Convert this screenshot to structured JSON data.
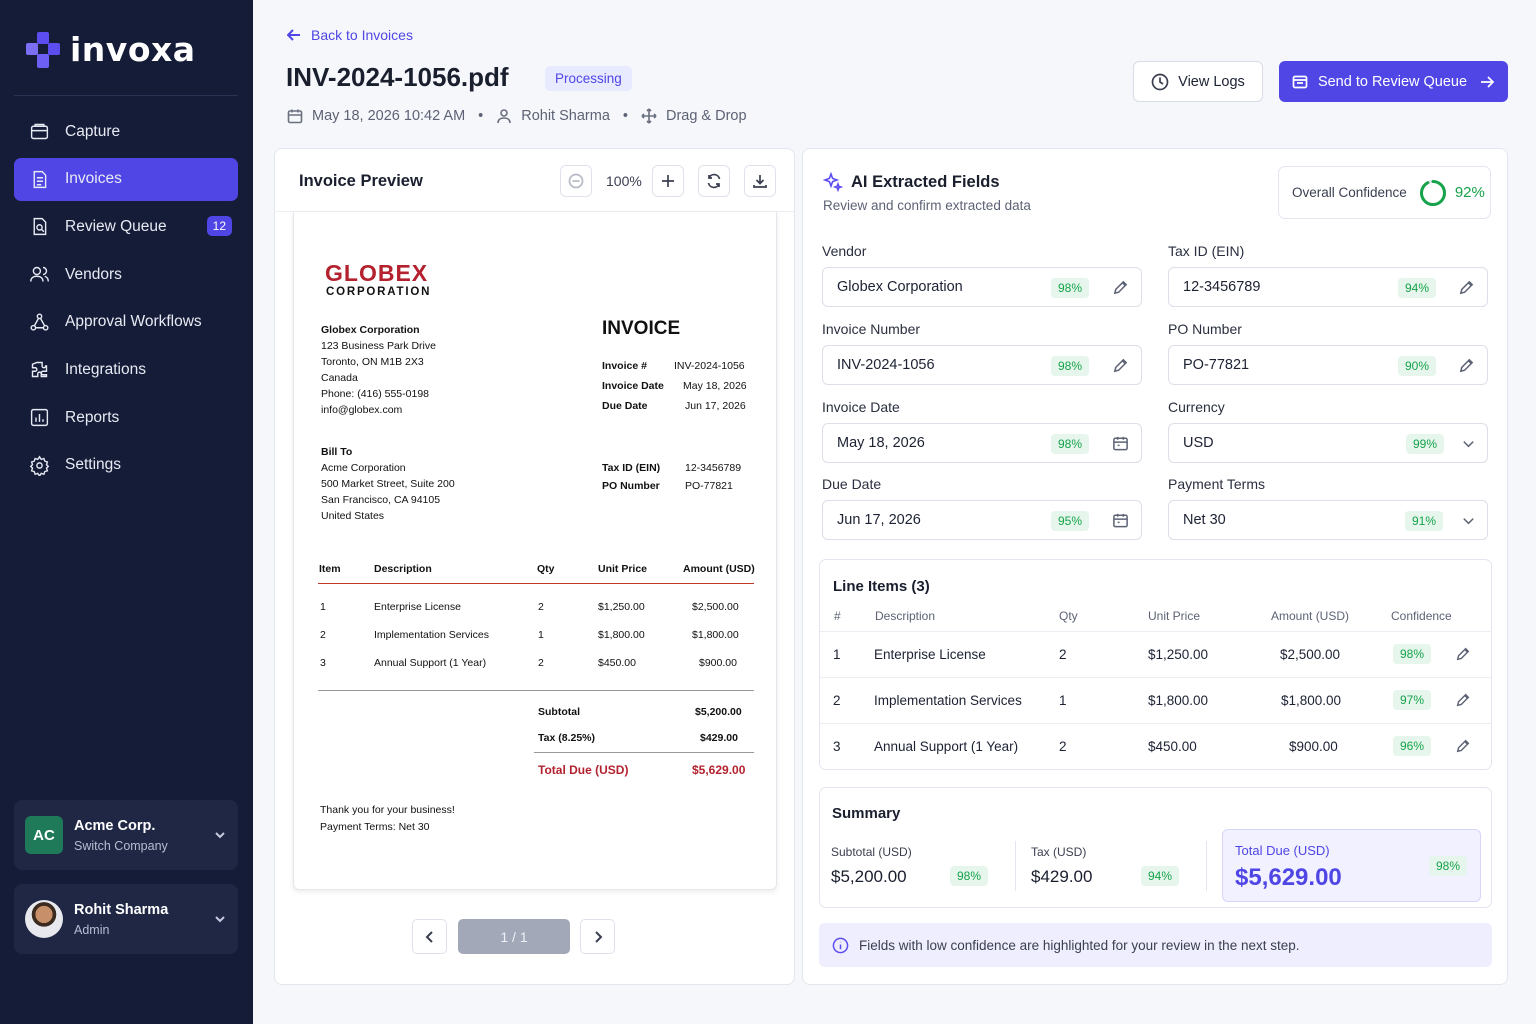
{
  "app": {
    "name": "invoxa"
  },
  "sidebar": {
    "items": [
      {
        "label": "Capture",
        "icon": "capture-icon"
      },
      {
        "label": "Invoices",
        "icon": "invoice-icon",
        "active": true
      },
      {
        "label": "Review Queue",
        "icon": "review-icon",
        "badge": "12"
      },
      {
        "label": "Vendors",
        "icon": "users-icon"
      },
      {
        "label": "Approval Workflows",
        "icon": "workflow-icon"
      },
      {
        "label": "Integrations",
        "icon": "puzzle-icon"
      },
      {
        "label": "Reports",
        "icon": "chart-icon"
      },
      {
        "label": "Settings",
        "icon": "gear-icon"
      }
    ],
    "org": {
      "initials": "AC",
      "name": "Acme Corp.",
      "action": "Switch Company"
    },
    "user": {
      "name": "Rohit Sharma",
      "role": "Admin"
    }
  },
  "header": {
    "back_label": "Back to Invoices",
    "title": "INV-2024-1056.pdf",
    "status": "Processing",
    "datetime": "May 18, 2026 10:42 AM",
    "uploader": "Rohit Sharma",
    "source": "Drag & Drop",
    "view_logs_label": "View Logs",
    "send_label": "Send to Review Queue"
  },
  "preview": {
    "title": "Invoice Preview",
    "zoom": "100%",
    "page_indicator": "1 / 1",
    "doc": {
      "brand": "GLOBEX",
      "brand_sub": "CORPORATION",
      "heading": "INVOICE",
      "from": [
        "Globex Corporation",
        "123 Business Park Drive",
        "Toronto, ON M1B 2X3",
        "Canada",
        "Phone: (416) 555-0198",
        "info@globex.com"
      ],
      "bill_to_label": "Bill To",
      "bill_to": [
        "Acme Corporation",
        "500 Market Street, Suite 200",
        "San Francisco, CA 94105",
        "United States"
      ],
      "meta": [
        {
          "label": "Invoice #",
          "value": "INV-2024-1056"
        },
        {
          "label": "Invoice Date",
          "value": "May 18, 2026"
        },
        {
          "label": "Due Date",
          "value": "Jun 17, 2026"
        }
      ],
      "meta2": [
        {
          "label": "Tax ID (EIN)",
          "value": "12-3456789"
        },
        {
          "label": "PO Number",
          "value": "PO-77821"
        }
      ],
      "columns": [
        "Item",
        "Description",
        "Qty",
        "Unit Price",
        "Amount (USD)"
      ],
      "rows": [
        [
          "1",
          "Enterprise License",
          "2",
          "$1,250.00",
          "$2,500.00"
        ],
        [
          "2",
          "Implementation Services",
          "1",
          "$1,800.00",
          "$1,800.00"
        ],
        [
          "3",
          "Annual Support (1 Year)",
          "2",
          "$450.00",
          "$900.00"
        ]
      ],
      "subtotal_label": "Subtotal",
      "subtotal": "$5,200.00",
      "tax_label": "Tax (8.25%)",
      "tax": "$429.00",
      "total_label": "Total Due (USD)",
      "total": "$5,629.00",
      "footer": [
        "Thank you for your business!",
        "Payment Terms: Net 30"
      ]
    }
  },
  "extract": {
    "title": "AI Extracted Fields",
    "subtitle": "Review and confirm extracted data",
    "confidence_label": "Overall Confidence",
    "confidence": "92%",
    "confidence_fraction": 0.92,
    "fields": [
      {
        "label": "Vendor",
        "value": "Globex Corporation",
        "conf": "98%",
        "icon": "edit-icon"
      },
      {
        "label": "Tax ID (EIN)",
        "value": "12-3456789",
        "conf": "94%",
        "icon": "edit-icon"
      },
      {
        "label": "Invoice Number",
        "value": "INV-2024-1056",
        "conf": "98%",
        "icon": "edit-icon"
      },
      {
        "label": "PO Number",
        "value": "PO-77821",
        "conf": "90%",
        "icon": "edit-icon"
      },
      {
        "label": "Invoice Date",
        "value": "May 18, 2026",
        "conf": "98%",
        "icon": "calendar-icon"
      },
      {
        "label": "Currency",
        "value": "USD",
        "conf": "99%",
        "icon": "chevron-down-icon"
      },
      {
        "label": "Due Date",
        "value": "Jun 17, 2026",
        "conf": "95%",
        "icon": "calendar-icon"
      },
      {
        "label": "Payment Terms",
        "value": "Net 30",
        "conf": "91%",
        "icon": "chevron-down-icon"
      }
    ],
    "line_items": {
      "title": "Line Items (3)",
      "columns": [
        "#",
        "Description",
        "Qty",
        "Unit Price",
        "Amount (USD)",
        "Confidence"
      ],
      "rows": [
        {
          "n": "1",
          "desc": "Enterprise License",
          "qty": "2",
          "unit": "$1,250.00",
          "amount": "$2,500.00",
          "conf": "98%"
        },
        {
          "n": "2",
          "desc": "Implementation Services",
          "qty": "1",
          "unit": "$1,800.00",
          "amount": "$1,800.00",
          "conf": "97%"
        },
        {
          "n": "3",
          "desc": "Annual Support (1 Year)",
          "qty": "2",
          "unit": "$450.00",
          "amount": "$900.00",
          "conf": "96%"
        }
      ]
    },
    "summary": {
      "title": "Summary",
      "subtotal_label": "Subtotal (USD)",
      "subtotal": "$5,200.00",
      "subtotal_conf": "98%",
      "tax_label": "Tax (USD)",
      "tax": "$429.00",
      "tax_conf": "94%",
      "total_label": "Total Due (USD)",
      "total": "$5,629.00",
      "total_conf": "98%"
    },
    "notice": "Fields with low confidence are highlighted for your review in the next step."
  },
  "colors": {
    "accent": "#4f46e5",
    "sidebar": "#151c38",
    "success": "#16a34a",
    "brand_red": "#b3222e"
  }
}
